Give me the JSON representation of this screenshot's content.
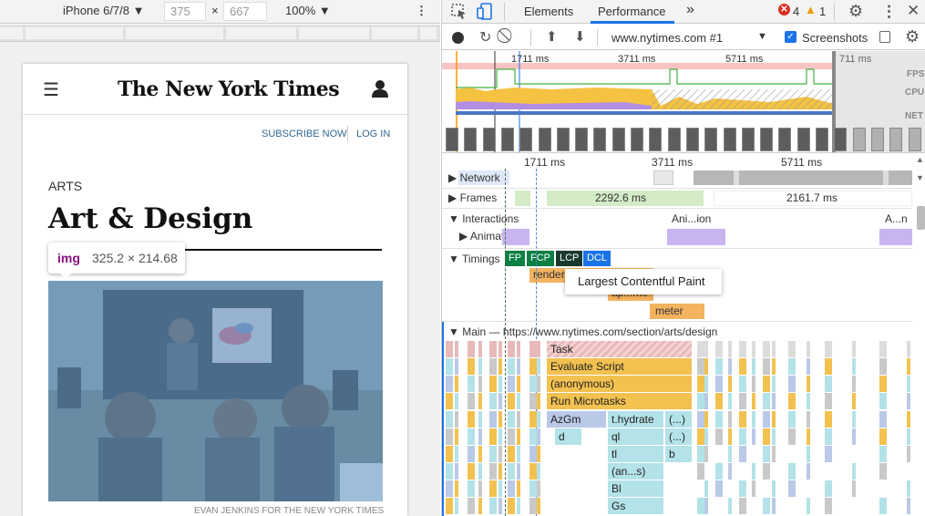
{
  "device_toolbar": {
    "device": "iPhone 6/7/8",
    "width": "375",
    "times": "×",
    "height": "667",
    "zoom": "100%"
  },
  "page": {
    "subscribe": "SUBSCRIBE NOW",
    "login": "LOG IN",
    "section": "ARTS",
    "title": "Art & Design",
    "tooltip_tag": "img",
    "tooltip_size": "325.2 × 214.68",
    "credit": "EVAN JENKINS FOR THE NEW YORK TIMES",
    "logo": "The New York Times"
  },
  "devtools": {
    "tabs": [
      "Elements",
      "Performance"
    ],
    "more": "»",
    "errors": "4",
    "warnings": "1",
    "url": "www.nytimes.com #1",
    "screenshots": "Screenshots",
    "overview_ticks": [
      "1711 ms",
      "3711 ms",
      "5711 ms",
      "711 ms"
    ],
    "overview_labels": [
      "FPS",
      "CPU",
      "NET"
    ],
    "main_ticks": [
      "1711 ms",
      "3711 ms",
      "5711 ms"
    ],
    "tracks": {
      "network": "Network",
      "frames": "Frames",
      "frame1": "2292.6 ms",
      "frame2": "2161.7 ms",
      "interactions": "Interactions",
      "interaction1": "Ani...ion",
      "interaction2": "A...n",
      "animation": "Animation",
      "timings": "Timings",
      "fp": "FP",
      "fcp": "FCP",
      "lcp": "LCP",
      "dcl": "DCL",
      "render": "render",
      "apme": "ap...me",
      "meter": "meter",
      "tooltip": "Largest Contentful Paint",
      "main": "Main — https://www.nytimes.com/section/arts/design"
    },
    "flame": {
      "task": "Task",
      "evaluate": "Evaluate Script",
      "anonymous": "(anonymous)",
      "microtasks": "Run Microtasks",
      "azgm": "AzGm",
      "hydrate": "t.hydrate",
      "ellipsis1": "(...)",
      "d": "d",
      "ql": "ql",
      "ellipsis2": "(...)",
      "tl": "tl",
      "b": "b",
      "ans": "(an...s)",
      "bl": "Bl",
      "gs": "Gs"
    }
  }
}
